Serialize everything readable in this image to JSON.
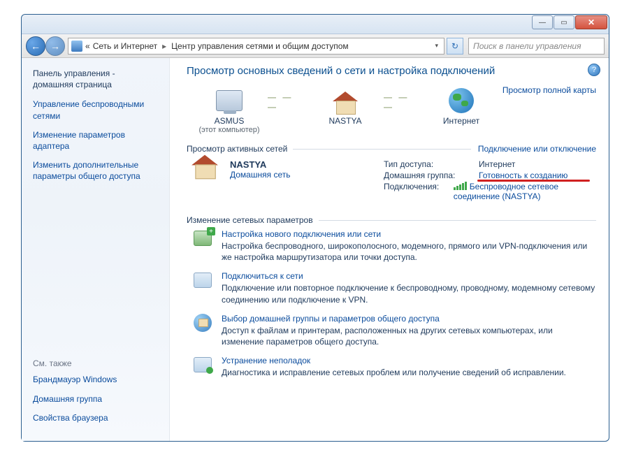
{
  "titlebar": {
    "min": "—",
    "max": "▭",
    "close": "✕"
  },
  "nav": {
    "bc1": "Сеть и Интернет",
    "bc2": "Центр управления сетями и общим доступом",
    "prefix": "«",
    "search_placeholder": "Поиск в панели управления"
  },
  "sidebar": {
    "home1": "Панель управления -",
    "home2": "домашняя страница",
    "links": [
      "Управление беспроводными сетями",
      "Изменение параметров адаптера",
      "Изменить дополнительные параметры общего доступа"
    ],
    "also_hdr": "См. также",
    "also": [
      "Брандмауэр Windows",
      "Домашняя группа",
      "Свойства браузера"
    ]
  },
  "main": {
    "title": "Просмотр основных сведений о сети и настройка подключений",
    "fullmap": "Просмотр полной карты",
    "nodes": {
      "pc": "ASMUS",
      "pc_sub": "(этот компьютер)",
      "nw": "NASTYA",
      "inet": "Интернет"
    },
    "active_hdr": "Просмотр активных сетей",
    "active_link": "Подключение или отключение",
    "net": {
      "name": "NASTYA",
      "type": "Домашняя сеть"
    },
    "rows": {
      "k1": "Тип доступа:",
      "v1": "Интернет",
      "k2": "Домашняя группа:",
      "v2": "Готовность к созданию",
      "k3": "Подключения:",
      "v3": "Беспроводное сетевое соединение (NASTYA)"
    },
    "change_hdr": "Изменение сетевых параметров",
    "tasks": [
      {
        "t": "Настройка нового подключения или сети",
        "d": "Настройка беспроводного, широкополосного, модемного, прямого или VPN-подключения или же настройка маршрутизатора или точки доступа."
      },
      {
        "t": "Подключиться к сети",
        "d": "Подключение или повторное подключение к беспроводному, проводному, модемному сетевому соединению или подключение к VPN."
      },
      {
        "t": "Выбор домашней группы и параметров общего доступа",
        "d": "Доступ к файлам и принтерам, расположенных на других сетевых компьютерах, или изменение параметров общего доступа."
      },
      {
        "t": "Устранение неполадок",
        "d": "Диагностика и исправление сетевых проблем или получение сведений об исправлении."
      }
    ]
  }
}
